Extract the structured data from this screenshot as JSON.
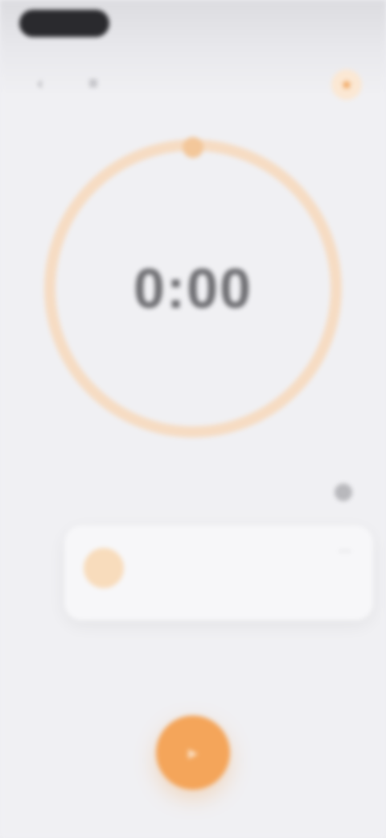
{
  "status_bar": {
    "left_text": "",
    "right_text": ""
  },
  "nav": {
    "back_icon": "chevron-left-icon",
    "menu_icon": "list-icon",
    "badge_icon": "star-icon"
  },
  "timer": {
    "label": "",
    "value": "0:00",
    "sub": "",
    "ring_progress": 0.0
  },
  "section": {
    "title": "",
    "action_label": "",
    "caption": ""
  },
  "card": {
    "title": "",
    "description": "",
    "meta": ""
  },
  "fab": {
    "icon": "play-icon"
  },
  "colors": {
    "accent": "#f4a55a",
    "ring": "#f6dcc3",
    "background": "#f0f0f3"
  }
}
